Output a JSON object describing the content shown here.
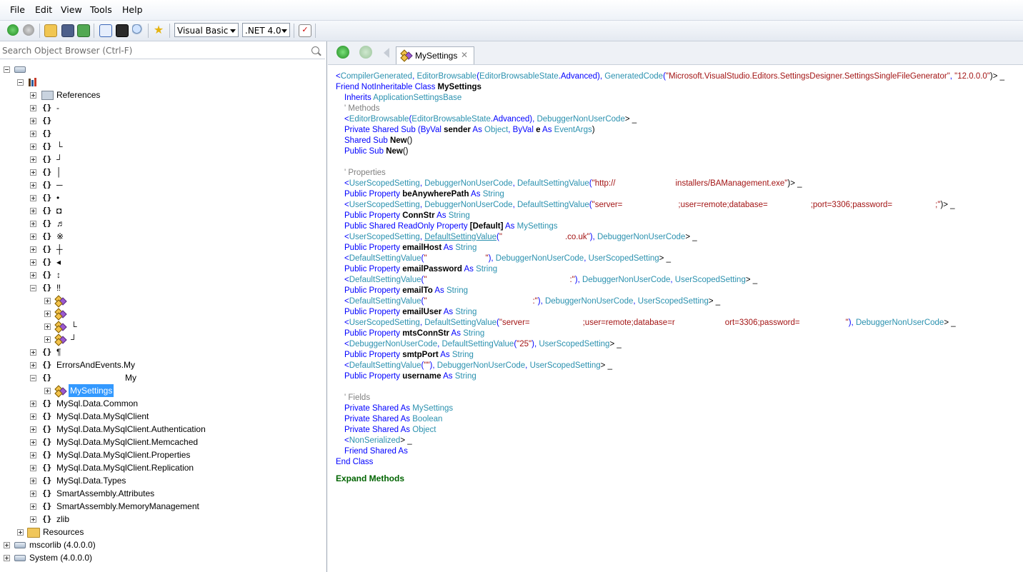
{
  "menu": [
    "File",
    "Edit",
    "View",
    "Tools",
    "Help"
  ],
  "toolbar": {
    "language": "Visual Basic",
    "framework": ".NET 4.0"
  },
  "search": {
    "placeholder": "Search Object Browser (Ctrl-F)"
  },
  "tree": {
    "references": "References",
    "glyphs": [
      "-",
      "",
      "",
      "└",
      "┘",
      "│",
      "─",
      "•",
      "◘",
      "♬",
      "※",
      "┼",
      "◂",
      "↕",
      "‼"
    ],
    "sub_glyphs": [
      "",
      "",
      "└",
      "┘"
    ],
    "pilcrow": "¶",
    "errors_events": "ErrorsAndEvents.My",
    "my_ns": "My",
    "my_settings": "MySettings",
    "namespaces": [
      "MySql.Data.Common",
      "MySql.Data.MySqlClient",
      "MySql.Data.MySqlClient.Authentication",
      "MySql.Data.MySqlClient.Memcached",
      "MySql.Data.MySqlClient.Properties",
      "MySql.Data.MySqlClient.Replication",
      "MySql.Data.Types",
      "SmartAssembly.Attributes",
      "SmartAssembly.MemoryManagement",
      "zlib"
    ],
    "resources": "Resources",
    "mscorlib": "mscorlib (4.0.0.0)",
    "system": "System (4.0.0.0)"
  },
  "tab": {
    "title": "MySettings"
  },
  "code": {
    "l1": {
      "a": "<",
      "b": "CompilerGenerated",
      "c": ", ",
      "d": "EditorBrowsable",
      "e": "(",
      "f": "EditorBrowsableState",
      "g": ".Advanced), ",
      "h": "GeneratedCode",
      "i": "(",
      "j": "\"Microsoft.VisualStudio.Editors.SettingsDesigner.SettingsSingleFileGenerator\"",
      "k": ", ",
      "l": "\"12.0.0.0\"",
      "m": ")> _"
    },
    "l2": {
      "a": "Friend NotInheritable Class ",
      "b": "MySettings"
    },
    "l3": {
      "a": "Inherits ",
      "b": "ApplicationSettingsBase"
    },
    "l4": "' Methods",
    "l5": {
      "a": "<",
      "b": "EditorBrowsable",
      "c": "(",
      "d": "EditorBrowsableState",
      "e": ".Advanced), ",
      "f": "DebuggerNonUserCode",
      "g": "> _"
    },
    "l6": {
      "a": "Private Shared Sub ",
      "b": "(ByVal ",
      "c": "sender",
      "d": " As ",
      "e": "Object",
      "f": ", ByVal ",
      "g": "e",
      "h": " As ",
      "i": "EventArgs",
      "j": ")"
    },
    "l7": {
      "a": "Shared Sub ",
      "b": "New",
      "c": "()"
    },
    "l8": {
      "a": "Public Sub ",
      "b": "New",
      "c": "()"
    },
    "l9": "' Properties",
    "l10": {
      "a": "<",
      "b": "UserScopedSetting",
      "c": ", ",
      "d": "DebuggerNonUserCode",
      "e": ", ",
      "f": "DefaultSettingValue",
      "g": "(",
      "h": "\"http://",
      "i": "installers/BAManagement.exe\"",
      "j": ")> _"
    },
    "l11": {
      "a": "Public Property ",
      "b": "beAnywherePath",
      "c": " As ",
      "d": "String"
    },
    "l12": {
      "a": "<",
      "b": "UserScopedSetting",
      "c": ", ",
      "d": "DebuggerNonUserCode",
      "e": ", ",
      "f": "DefaultSettingValue",
      "g": "(",
      "h": "\"server=",
      "i": ";user=remote;database=",
      "j": ";port=3306;password=",
      "k": ";\"",
      "l": ")> _"
    },
    "l13": {
      "a": "Public Property ",
      "b": "ConnStr",
      "c": " As ",
      "d": "String"
    },
    "l14": {
      "a": "Public Shared ReadOnly Property ",
      "b": "[Default]",
      "c": " As ",
      "d": "MySettings"
    },
    "l15": {
      "a": "<",
      "b": "UserScopedSetting",
      "c": ", ",
      "d": "DefaultSettingValue",
      "e": "(",
      "f": "\"",
      "g": ".co.uk\"",
      "h": "), ",
      "i": "DebuggerNonUserCode",
      "j": "> _"
    },
    "l16": {
      "a": "Public Property ",
      "b": "emailHost",
      "c": " As ",
      "d": "String"
    },
    "l17": {
      "a": "<",
      "b": "DefaultSettingValue",
      "c": "(",
      "d": "\"",
      "e": "\"",
      "f": "), ",
      "g": "DebuggerNonUserCode",
      "h": ", ",
      "i": "UserScopedSetting",
      "j": "> _"
    },
    "l18": {
      "a": "Public Property ",
      "b": "emailPassword",
      "c": " As ",
      "d": "String"
    },
    "l19": {
      "a": "<",
      "b": "DefaultSettingValue",
      "c": "(",
      "d": "\"",
      "e": ":\"",
      "f": "), ",
      "g": "DebuggerNonUserCode",
      "h": ", ",
      "i": "UserScopedSetting",
      "j": "> _"
    },
    "l20": {
      "a": "Public Property ",
      "b": "emailTo",
      "c": " As ",
      "d": "String"
    },
    "l21": {
      "a": "<",
      "b": "DefaultSettingValue",
      "c": "(",
      "d": "\"",
      "e": ":\"",
      "f": "), ",
      "g": "DebuggerNonUserCode",
      "h": ", ",
      "i": "UserScopedSetting",
      "j": "> _"
    },
    "l22": {
      "a": "Public Property ",
      "b": "emailUser",
      "c": " As ",
      "d": "String"
    },
    "l23": {
      "a": "<",
      "b": "UserScopedSetting",
      "c": ", ",
      "d": "DefaultSettingValue",
      "e": "(",
      "f": "\"server=",
      "g": ";user=remote;database=r",
      "h": "ort=3306;password=",
      "i": "\"",
      "j": "), ",
      "k": "DebuggerNonUserCode",
      "l": "> _"
    },
    "l24": {
      "a": "Public Property ",
      "b": "mtsConnStr",
      "c": " As ",
      "d": "String"
    },
    "l25": {
      "a": "<",
      "b": "DebuggerNonUserCode",
      "c": ", ",
      "d": "DefaultSettingValue",
      "e": "(",
      "f": "\"25\"",
      "g": "), ",
      "h": "UserScopedSetting",
      "i": "> _"
    },
    "l26": {
      "a": "Public Property ",
      "b": "smtpPort",
      "c": " As ",
      "d": "String"
    },
    "l27": {
      "a": "<",
      "b": "DefaultSettingValue",
      "c": "(",
      "d": "\"\"",
      "e": "), ",
      "f": "DebuggerNonUserCode",
      "g": ", ",
      "h": "UserScopedSetting",
      "i": "> _"
    },
    "l28": {
      "a": "Public Property ",
      "b": "username",
      "c": " As ",
      "d": "String"
    },
    "l29": "' Fields",
    "l30": {
      "a": "Private Shared  As ",
      "b": "MySettings"
    },
    "l31": {
      "a": "Private Shared  As ",
      "b": "Boolean"
    },
    "l32": {
      "a": "Private Shared  As ",
      "b": "Object"
    },
    "l33": {
      "a": "<",
      "b": "NonSerialized",
      "c": "> _"
    },
    "l34": {
      "a": "Friend Shared  As"
    },
    "l35": "End Class",
    "expand": "Expand Methods"
  },
  "colors": {
    "keyword": "#0000ff",
    "type": "#2b91af",
    "attribute": "#008000",
    "string": "#a31515",
    "comment": "#808080",
    "selection": "#3399ff"
  }
}
